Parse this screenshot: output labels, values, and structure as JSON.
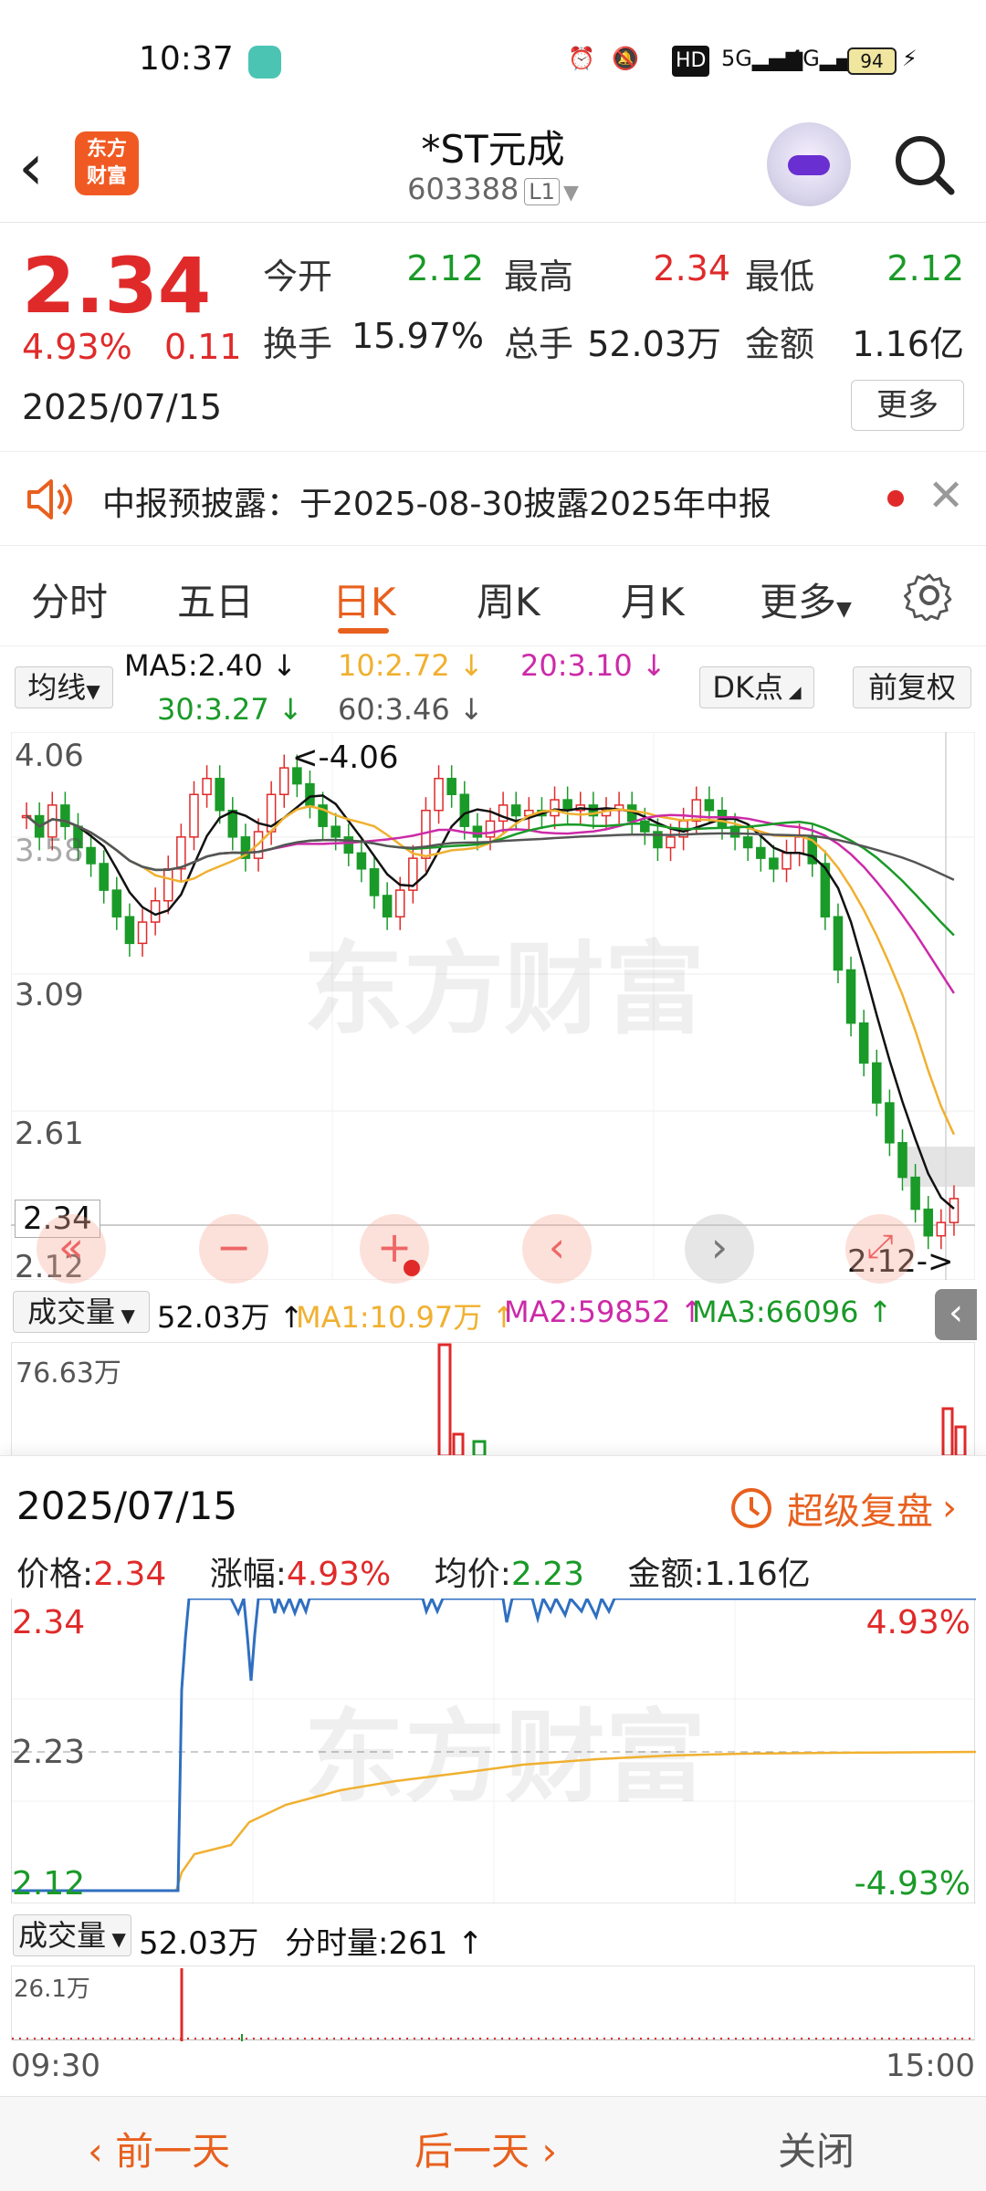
{
  "status_bar": {
    "time": "10:37",
    "battery": "94",
    "net1": "5G",
    "net2": "4G",
    "hd": "HD"
  },
  "header": {
    "logo_text": "东方\n财富",
    "name": "*ST元成",
    "code": "603388",
    "level": "L1"
  },
  "quote": {
    "price": "2.34",
    "change_pct": "4.93%",
    "change": "0.11",
    "date": "2025/07/15",
    "labels": {
      "open": "今开",
      "high": "最高",
      "low": "最低",
      "turnover": "换手",
      "volume": "总手",
      "amount": "金额"
    },
    "open": "2.12",
    "high": "2.34",
    "low": "2.12",
    "turnover": "15.97%",
    "volume": "52.03万",
    "amount": "1.16亿",
    "more": "更多"
  },
  "notice": {
    "text": "中报预披露：于2025-08-30披露2025年中报"
  },
  "tabs": [
    "分时",
    "五日",
    "日K",
    "周K",
    "月K",
    "更多"
  ],
  "ma_bar": {
    "selector": "均线",
    "ma5": "MA5:2.40",
    "ma10": "10:2.72",
    "ma20": "20:3.10",
    "ma30": "30:3.27",
    "ma60": "60:3.46",
    "dk": "DK点",
    "adjust": "前复权"
  },
  "kchart": {
    "y_labels": [
      "4.06",
      "3.58",
      "3.09",
      "2.61",
      "2.12"
    ],
    "max_marker": "<-4.06",
    "min_marker": "2.12->",
    "current": "2.34",
    "watermark": "东方财富"
  },
  "volume_bar": {
    "selector": "成交量",
    "vol": "52.03万",
    "ma1": "MA1:10.97万",
    "ma2": "MA2:59852",
    "ma3": "MA3:66096",
    "max": "76.63万"
  },
  "panel": {
    "date": "2025/07/15",
    "replay": "超级复盘",
    "price_label": "价格:",
    "price": "2.34",
    "pct_label": "涨幅:",
    "pct": "4.93%",
    "avg_label": "均价:",
    "avg": "2.23",
    "amt_label": "金额:",
    "amt": "1.16亿",
    "y_top": "2.34",
    "y_mid": "2.23",
    "y_bot": "2.12",
    "pct_top": "4.93%",
    "pct_bot": "-4.93%",
    "vol_selector": "成交量",
    "vol": "52.03万",
    "tick_vol": "分时量:261",
    "vol_max": "26.1万",
    "time_start": "09:30",
    "time_end": "15:00"
  },
  "footer": {
    "prev": "前一天",
    "next": "后一天",
    "close": "关闭"
  },
  "colors": {
    "up": "#e02a2a",
    "down": "#1a9a28",
    "accent": "#e8601e",
    "ma5": "#111111",
    "ma10": "#f0b030",
    "ma20": "#cc2aa8",
    "ma30": "#1a9a28",
    "ma60": "#555555"
  }
}
